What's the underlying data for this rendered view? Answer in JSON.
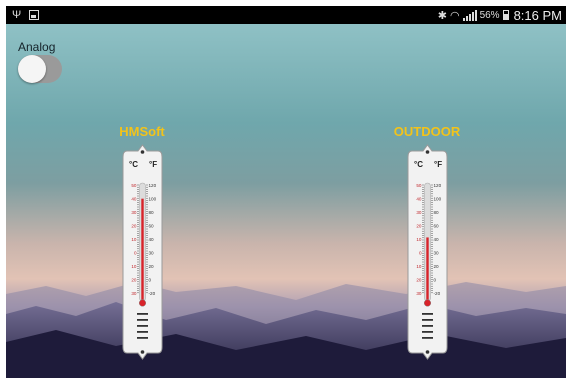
{
  "status_bar": {
    "left_icons": [
      "usb-icon",
      "image-icon"
    ],
    "battery_percent": "56%",
    "time": "8:16 PM"
  },
  "toggle": {
    "label": "Analog",
    "state": "off"
  },
  "thermometers": [
    {
      "title": "HMSoft",
      "celsius_label": "°C",
      "fahrenheit_label": "°F",
      "reading_fraction": 0.88
    },
    {
      "title": "OUTDOOR",
      "celsius_label": "°C",
      "fahrenheit_label": "°F",
      "reading_fraction": 0.54
    }
  ],
  "scale": {
    "celsius_ticks": [
      "50",
      "40",
      "30",
      "20",
      "10",
      "0",
      "10",
      "20",
      "30"
    ],
    "fahrenheit_ticks": [
      "120",
      "100",
      "80",
      "60",
      "40",
      "30",
      "20",
      "0",
      "-20"
    ]
  },
  "colors": {
    "title": "#f2c31a",
    "mercury": "#d8232a",
    "toggle_track": "#9a9a9a"
  }
}
